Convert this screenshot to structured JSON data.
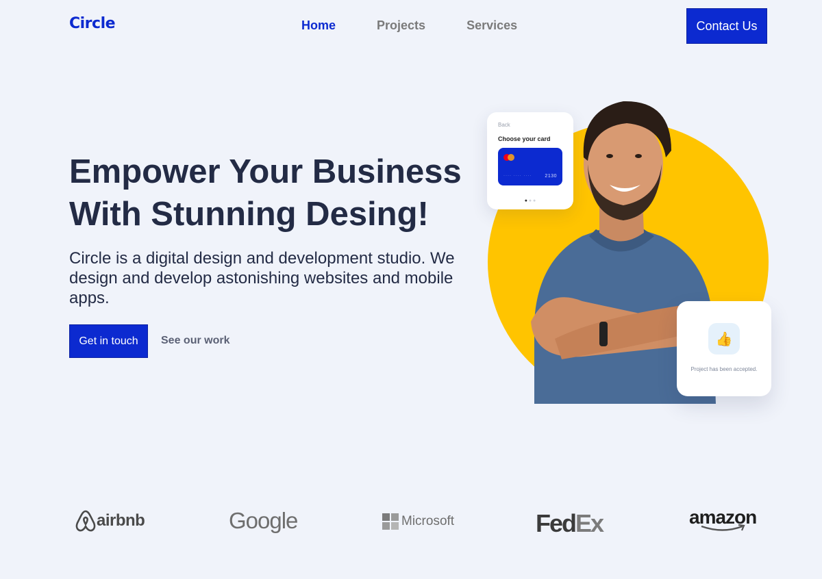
{
  "brand": {
    "logo": "Circle",
    "accent_color": "#0c2ad0",
    "highlight_color": "#ffc400"
  },
  "nav": {
    "items": [
      {
        "label": "Home",
        "active": true
      },
      {
        "label": "Projects",
        "active": false
      },
      {
        "label": "Services",
        "active": false
      }
    ],
    "contact_label": "Contact Us"
  },
  "hero": {
    "title_line1": "Empower Your Business",
    "title_line2": "With Stunning Desing!",
    "description": "Circle is a digital design and development studio. We design and develop astonishing websites and mobile apps.",
    "primary_cta": "Get in touch",
    "secondary_cta": "See our work"
  },
  "card_widget": {
    "back_label": "Back",
    "title": "Choose your card",
    "card_digits": "2130",
    "card_mask": "···· ···· ····"
  },
  "accept_widget": {
    "icon": "thumbs-up-icon",
    "text": "Project has been accepted."
  },
  "partners": [
    "airbnb",
    "Google",
    "Microsoft",
    "FedEx",
    "amazon"
  ]
}
